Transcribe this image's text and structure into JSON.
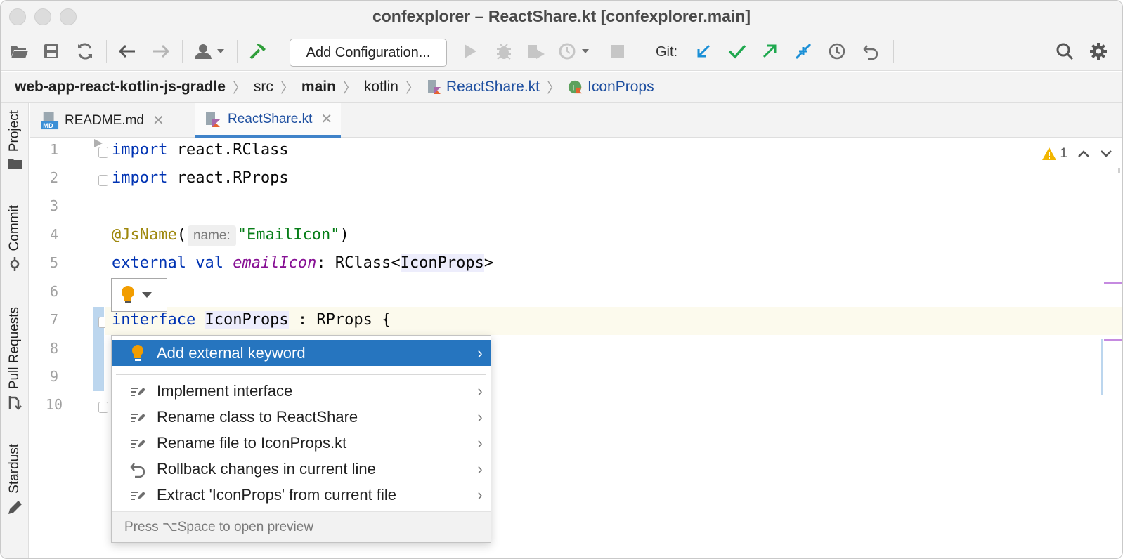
{
  "window": {
    "title": "confexplorer – ReactShare.kt [confexplorer.main]"
  },
  "toolbar": {
    "run_config_label": "Add Configuration...",
    "git_label": "Git:"
  },
  "breadcrumbs": [
    {
      "label": "web-app-react-kotlin-js-gradle"
    },
    {
      "label": "src"
    },
    {
      "label": "main"
    },
    {
      "label": "kotlin"
    },
    {
      "label": "ReactShare.kt"
    },
    {
      "label": "IconProps"
    }
  ],
  "left_tools": [
    "Project",
    "Commit",
    "Pull Requests",
    "Stardust"
  ],
  "tabs": [
    {
      "label": "README.md",
      "icon_badge": "MD"
    },
    {
      "label": "ReactShare.kt"
    }
  ],
  "editor": {
    "line_numbers": [
      "1",
      "2",
      "3",
      "4",
      "5",
      "6",
      "7",
      "8",
      "9",
      "10"
    ],
    "lines": {
      "l1_kw": "import",
      "l1_rest": " react.RClass",
      "l2_kw": "import",
      "l2_rest": " react.RProps",
      "l4_anno": "@JsName",
      "l4_open": "(",
      "l4_hint": "name:",
      "l4_str": "\"EmailIcon\"",
      "l4_close": ")",
      "l5_kw1": "external",
      "l5_kw2": " val ",
      "l5_prop": "emailIcon",
      "l5_mid": ": RClass<",
      "l5_type": "IconProps",
      "l5_end": ">",
      "l7_kw": "interface",
      "l7_name": "IconProps",
      "l7_rest": " : RProps {"
    },
    "warnings_count": "1"
  },
  "popup": {
    "items": [
      {
        "label": "Add external keyword",
        "icon": "bulb-icon"
      },
      {
        "label": "Implement interface",
        "icon": "intention-icon"
      },
      {
        "label": "Rename class to ReactShare",
        "icon": "intention-icon"
      },
      {
        "label": "Rename file to IconProps.kt",
        "icon": "intention-icon"
      },
      {
        "label": "Rollback changes in current line",
        "icon": "rollback-icon"
      },
      {
        "label": "Extract 'IconProps' from current file",
        "icon": "intention-icon"
      }
    ],
    "footer": "Press ⌥Space to open preview"
  },
  "colors": {
    "accent": "#2675bf",
    "keyword": "#0033b3",
    "string": "#067d17",
    "annotation": "#9e880d",
    "property": "#871094",
    "git_blue": "#1a8fd6",
    "git_green": "#1fa84f"
  }
}
